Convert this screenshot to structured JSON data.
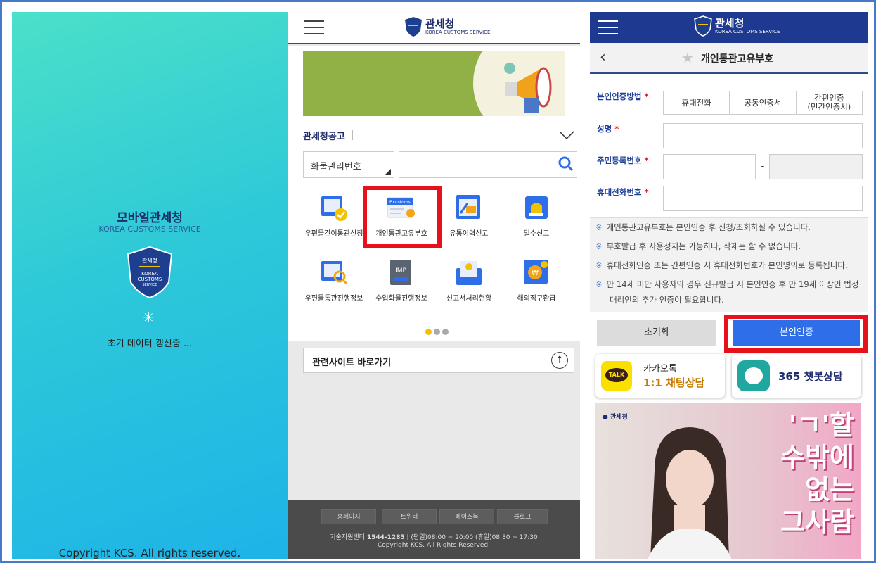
{
  "splash": {
    "title": "모바일관세청",
    "subtitle": "KOREA CUSTOMS SERVICE",
    "emblem_text": [
      "관세청",
      "KOREA",
      "CUSTOMS",
      "SERVICE"
    ],
    "status": "초기 데이터 갱신중 ...",
    "copyright": "Copyright KCS. All rights reserved."
  },
  "main": {
    "logo_ko": "관세청",
    "logo_en": "KOREA CUSTOMS SERVICE",
    "notice_label": "관세청공고",
    "search_select": "화물관리번호",
    "search_placeholder": "",
    "menu": [
      {
        "label": "우편물간이통관신청",
        "icon": "mail-check-icon"
      },
      {
        "label": "개인통관고유부호",
        "icon": "personal-customs-code-icon"
      },
      {
        "label": "유통이력신고",
        "icon": "distribution-report-icon"
      },
      {
        "label": "밀수신고",
        "icon": "smuggling-alarm-icon"
      },
      {
        "label": "우편물통관진행정보",
        "icon": "mail-search-icon"
      },
      {
        "label": "수입화물진행정보",
        "icon": "import-cargo-icon"
      },
      {
        "label": "신고서처리현황",
        "icon": "declaration-status-icon"
      },
      {
        "label": "해외직구환급",
        "icon": "overseas-refund-icon"
      }
    ],
    "card_text": "P.customs",
    "imp_text": "IMP",
    "related_label": "관련사이트 바로가기",
    "footer": {
      "links": [
        "홈페이지",
        "트위터",
        "페이스북",
        "블로그"
      ],
      "info_prefix": "기술지원센터",
      "phone": "1544-1285",
      "hours": "| (평일)08:00 ~ 20:00 (휴일)08:30 ~ 17:30",
      "copyright": "Copyright KCS. All Rights Reserved."
    }
  },
  "detail": {
    "page_title": "개인통관고유부호",
    "labels": {
      "auth_method": "본인인증방법",
      "name": "성명",
      "rrn": "주민등록번호",
      "phone": "휴대전화번호",
      "required": "*"
    },
    "auth_options": [
      "휴대전화",
      "공동인증서",
      "간편인증\n(민간인증서)"
    ],
    "dash": "-",
    "notes": [
      "개인통관고유부호는 본인인증 후 신청/조회하실 수 있습니다.",
      "부호발급 후 사용정지는 가능하나, 삭제는 할 수 없습니다.",
      "휴대전화인증 또는 간편인증 시 휴대전화번호가 본인명의로 등록됩니다.",
      "만 14세 미만 사용자의 경우 신규발급 시 본인인증 후 만 19세 이상인 법정대리인의 추가 인증이 필요합니다."
    ],
    "note_marker": "※",
    "btn_reset": "초기화",
    "btn_auth": "본인인증",
    "kakao_line1": "카카오톡",
    "kakao_line2": "1:1 채팅상담",
    "kakao_badge": "TALK",
    "chatbot": "365 챗봇상담",
    "ad_org": "관세청",
    "ad_text": [
      "'ㄱ'할",
      "수밖에",
      "없는",
      "그사람"
    ]
  },
  "colors": {
    "navy": "#1e2d6b",
    "header_blue": "#1d3a90",
    "accent_blue": "#2e6ee8",
    "highlight_red": "#e8111b",
    "banner_green": "#91b147"
  }
}
